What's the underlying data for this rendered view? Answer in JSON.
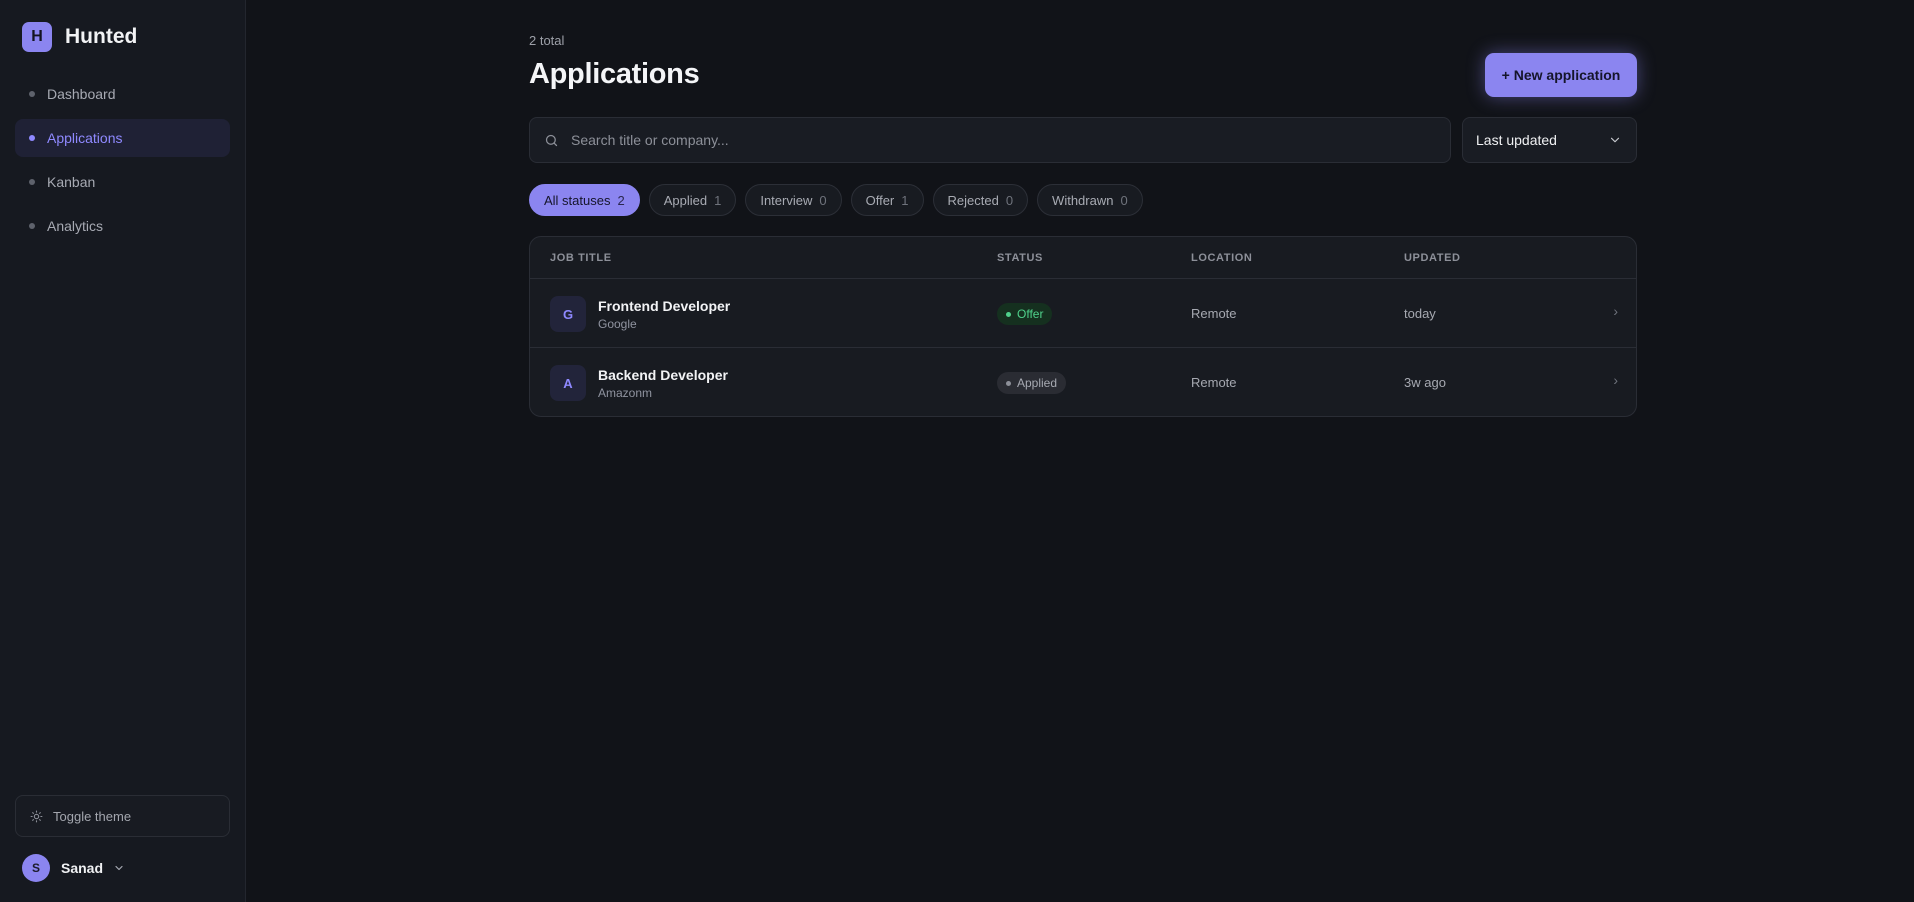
{
  "sidebar": {
    "brand_initial": "H",
    "brand_name": "Hunted",
    "items": [
      {
        "label": "Dashboard",
        "active": false
      },
      {
        "label": "Applications",
        "active": true
      },
      {
        "label": "Kanban",
        "active": false
      },
      {
        "label": "Analytics",
        "active": false
      }
    ],
    "toggle_theme_label": "Toggle theme",
    "user": {
      "initial": "S",
      "name": "Sanad"
    }
  },
  "header": {
    "total": "2 total",
    "title": "Applications",
    "new_button": "+ New application"
  },
  "search": {
    "placeholder": "Search title or company..."
  },
  "sort": {
    "selected": "Last updated"
  },
  "filters": [
    {
      "label": "All statuses",
      "count": "2",
      "active": true
    },
    {
      "label": "Applied",
      "count": "1",
      "active": false
    },
    {
      "label": "Interview",
      "count": "0",
      "active": false
    },
    {
      "label": "Offer",
      "count": "1",
      "active": false
    },
    {
      "label": "Rejected",
      "count": "0",
      "active": false
    },
    {
      "label": "Withdrawn",
      "count": "0",
      "active": false
    }
  ],
  "table": {
    "columns": [
      "JOB TITLE",
      "STATUS",
      "LOCATION",
      "UPDATED"
    ],
    "rows": [
      {
        "initial": "G",
        "title": "Frontend Developer",
        "company": "Google",
        "status": "Offer",
        "location": "Remote",
        "updated": "today",
        "chevron": "›"
      },
      {
        "initial": "A",
        "title": "Backend Developer",
        "company": "Amazonm",
        "status": "Applied",
        "location": "Remote",
        "updated": "3w ago",
        "chevron": "›"
      }
    ]
  },
  "colors": {
    "accent": "#8b85f0",
    "background": "#111318",
    "offer": "#4fd18b"
  }
}
